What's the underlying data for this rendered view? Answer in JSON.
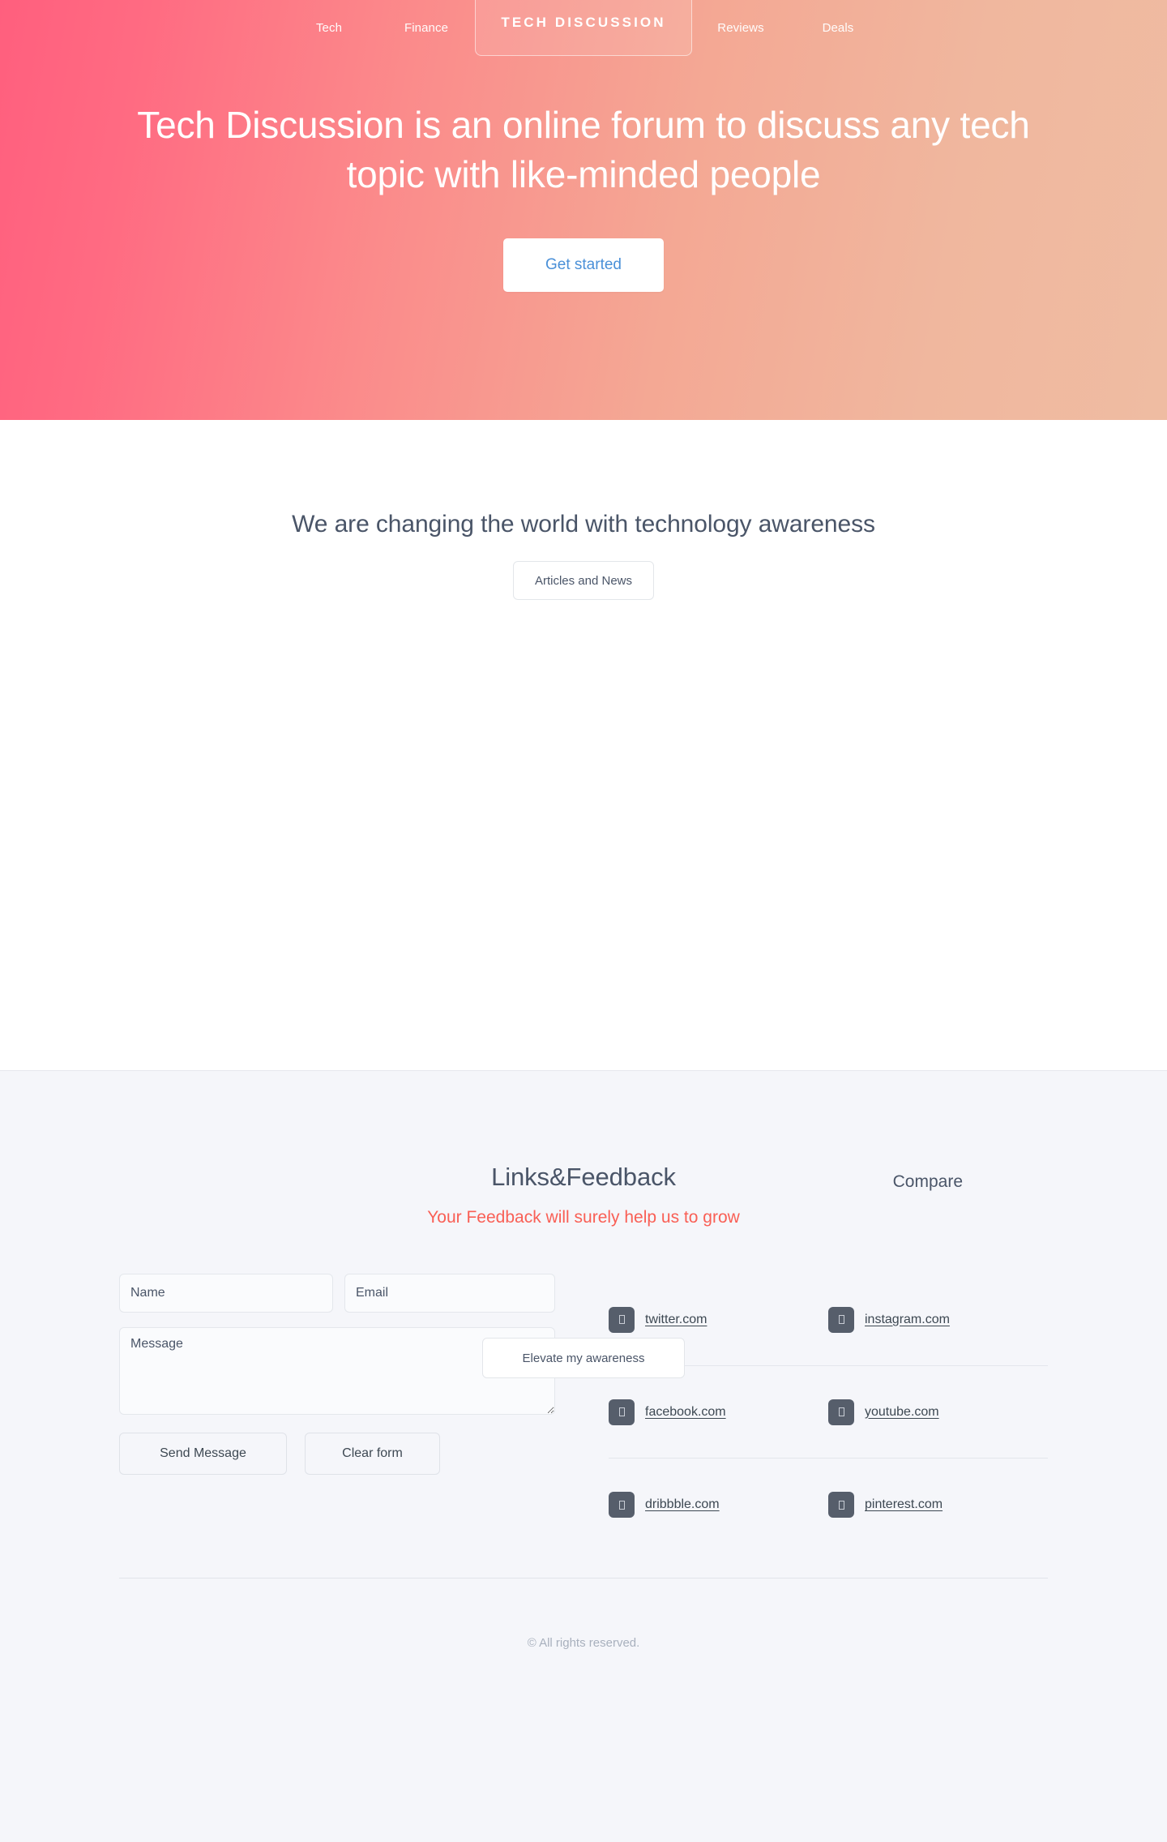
{
  "theme": {
    "hero_gradient_start": "#ff5f7e",
    "hero_gradient_end": "#efbca2",
    "accent_blue": "#4a90d8",
    "accent_red": "#f95f55",
    "text_dark": "#4a5568",
    "panel_gray": "#f5f6fa",
    "icon_tile": "#565e6b"
  },
  "nav": {
    "brand": "TECH DISCUSSION",
    "links_left": [
      {
        "label": "Tech",
        "name": "nav-link-tech"
      },
      {
        "label": "Finance",
        "name": "nav-link-finance"
      }
    ],
    "links_right": [
      {
        "label": "Reviews",
        "name": "nav-link-reviews"
      },
      {
        "label": "Deals",
        "name": "nav-link-deals"
      }
    ]
  },
  "hero": {
    "title": "Tech Discussion is an online forum to discuss any tech topic with like-minded people",
    "cta_label": "Get started"
  },
  "mid": {
    "heading": "We are changing the world with technology awareness",
    "articles_button": "Articles and News",
    "compare_label": "Compare",
    "elevate_button": "Elevate my awareness"
  },
  "feedback": {
    "heading": "Links&Feedback",
    "subheading": "Your Feedback will surely help us to grow",
    "form": {
      "name_placeholder": "Name",
      "name_value": "",
      "email_placeholder": "Email",
      "email_value": "",
      "message_placeholder": "Message",
      "message_value": "",
      "send_label": "Send Message",
      "clear_label": "Clear form"
    },
    "links": [
      [
        {
          "label": "twitter.com",
          "icon": "twitter-icon"
        },
        {
          "label": "instagram.com",
          "icon": "instagram-icon"
        }
      ],
      [
        {
          "label": "facebook.com",
          "icon": "facebook-icon"
        },
        {
          "label": "youtube.com",
          "icon": "youtube-icon"
        }
      ],
      [
        {
          "label": "dribbble.com",
          "icon": "dribbble-icon"
        },
        {
          "label": "pinterest.com",
          "icon": "pinterest-icon"
        }
      ]
    ]
  },
  "footer": {
    "copyright": "© All rights reserved."
  }
}
